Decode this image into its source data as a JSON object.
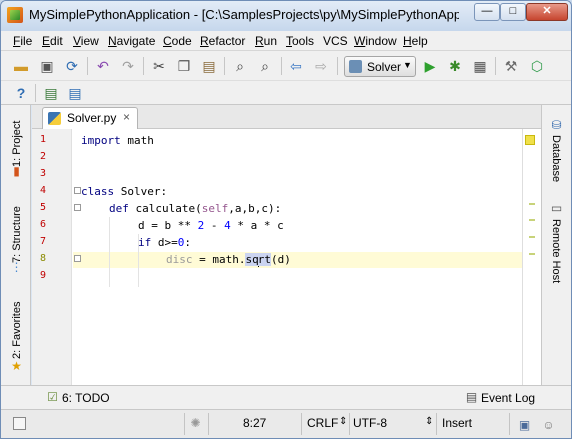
{
  "window": {
    "title": "MySimplePythonApplication - [C:\\SamplesProjects\\py\\MySimplePythonApplicat...",
    "controls": {
      "minimize": "—",
      "maximize": "□",
      "close": "✕"
    }
  },
  "menu": [
    {
      "label": "File",
      "u": "F",
      "rest": "ile"
    },
    {
      "label": "Edit",
      "u": "E",
      "rest": "dit"
    },
    {
      "label": "View",
      "u": "V",
      "rest": "iew"
    },
    {
      "label": "Navigate",
      "u": "N",
      "rest": "avigate"
    },
    {
      "label": "Code",
      "u": "C",
      "rest": "ode"
    },
    {
      "label": "Refactor",
      "u": "R",
      "rest": "efactor"
    },
    {
      "label": "Run",
      "u": "R",
      "rest": "un",
      "pre": ""
    },
    {
      "label": "Tools",
      "u": "T",
      "rest": "ools"
    },
    {
      "label": "VCS",
      "u": "",
      "rest": "VCS"
    },
    {
      "label": "Window",
      "u": "W",
      "rest": "indow"
    },
    {
      "label": "Help",
      "u": "H",
      "rest": "elp"
    }
  ],
  "toolbar": {
    "run_config_label": "Solver",
    "icons": [
      "open-folder-icon",
      "save-icon",
      "sync-icon",
      "undo-icon",
      "redo-icon",
      "cut-icon",
      "copy-icon",
      "paste-icon",
      "find-icon",
      "replace-icon",
      "back-icon",
      "forward-icon",
      "run-icon",
      "debug-icon",
      "coverage-icon",
      "settings-icon",
      "structure-icon",
      "help-icon",
      "vcs-update-icon",
      "vcs-commit-icon"
    ]
  },
  "side_tabs": {
    "left": [
      "1: Project",
      "7: Structure",
      "2: Favorites"
    ],
    "right": [
      "Database",
      "Remote Host"
    ]
  },
  "editor": {
    "tab_label": "Solver.py",
    "line_numbers": [
      "1",
      "2",
      "3",
      "4",
      "5",
      "6",
      "7",
      "8",
      "9"
    ],
    "current_line": 8,
    "lines": {
      "l1_kw": "import",
      "l1_rest": " math",
      "l4_kw": "class",
      "l4_rest": " Solver:",
      "l5_kw": "def",
      "l5_name": " calculate(",
      "l5_self": "self",
      "l5_rest": ",a,b,c):",
      "l6_a": "d = b ** ",
      "l6_n1": "2",
      "l6_b": " - ",
      "l6_n2": "4",
      "l6_c": " * a * c",
      "l7_kw": "if",
      "l7_a": " d>=",
      "l7_n": "0",
      "l7_b": ":",
      "l8_dim": "disc",
      "l8_a": " = math.",
      "l8_h1": "sq",
      "l8_h2": "rt",
      "l8_b": "(d)"
    }
  },
  "bottom": {
    "todo_label": "6: TODO",
    "event_log_label": "Event Log"
  },
  "status": {
    "position": "8:27",
    "line_sep": "CRLF",
    "encoding": "UTF-8",
    "mode": "Insert"
  },
  "colors": {
    "error_stripe": "#f0e04a",
    "current_line": "#fffbd6",
    "line_number": "#c00000"
  }
}
